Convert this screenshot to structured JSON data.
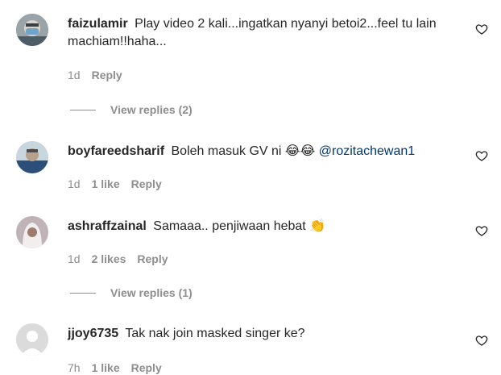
{
  "comments": [
    {
      "username": "faizulamir",
      "text": "Play video 2 kali...ingatkan nyanyi betoi2...feel tu lain machiam!!haha...",
      "time": "1d",
      "likes": "",
      "reply_label": "Reply",
      "view_replies": "View replies (2)",
      "avatar_icon": "avatar-masked-person"
    },
    {
      "username": "boyfareedsharif",
      "text": "Boleh masuk GV ni",
      "emojis": "😂😂",
      "mention": "@rozitachewan1",
      "time": "1d",
      "likes": "1 like",
      "reply_label": "Reply",
      "avatar_icon": "avatar-person"
    },
    {
      "username": "ashraffzainal",
      "text": "Samaaa.. penjiwaan hebat",
      "emojis": "👏",
      "time": "1d",
      "likes": "2 likes",
      "reply_label": "Reply",
      "view_replies": "View replies (1)",
      "avatar_icon": "avatar-veiled-person"
    },
    {
      "username": "jjoy6735",
      "text": "Tak nak join masked singer ke?",
      "time": "7h",
      "likes": "1 like",
      "reply_label": "Reply",
      "avatar_icon": "avatar-default"
    }
  ],
  "colors": {
    "text": "#262626",
    "secondary": "#8e8e8e",
    "mention": "#00376b"
  }
}
